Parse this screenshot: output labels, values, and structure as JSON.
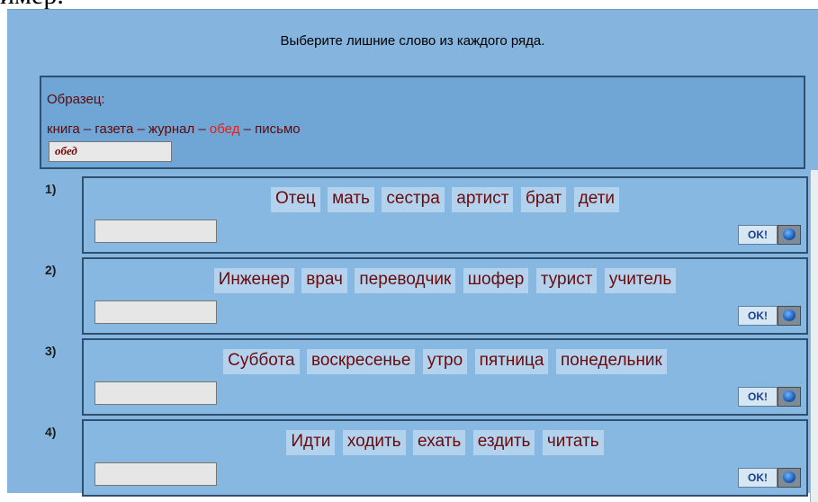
{
  "top_cut_text": "имер.",
  "heading": "Выберите лишние слово из каждого ряда.",
  "sample": {
    "title": "Образец:",
    "sentence_before": "книга – газета – журнал – ",
    "highlight": "обед",
    "sentence_after": " – письмо",
    "answer": "обед"
  },
  "tasks": [
    {
      "number": "1)",
      "words": [
        "Отец",
        "мать",
        "сестра",
        "артист",
        "брат",
        "дети"
      ],
      "answer": "",
      "ok_label": "OK!"
    },
    {
      "number": "2)",
      "words": [
        "Инженер",
        "врач",
        "переводчик",
        "шофер",
        "турист",
        "учитель"
      ],
      "answer": "",
      "ok_label": "OK!"
    },
    {
      "number": "3)",
      "words": [
        "Суббота",
        "воскресенье",
        "утро",
        "пятница",
        "понедельник"
      ],
      "answer": "",
      "ok_label": "OK!"
    },
    {
      "number": "4)",
      "words": [
        "Идти",
        "ходить",
        "ехать",
        "ездить",
        "читать"
      ],
      "answer": "",
      "ok_label": "OK!"
    }
  ],
  "colors": {
    "background": "#85b5de",
    "word_text": "#6b0a0a",
    "highlight": "#e0201a"
  }
}
